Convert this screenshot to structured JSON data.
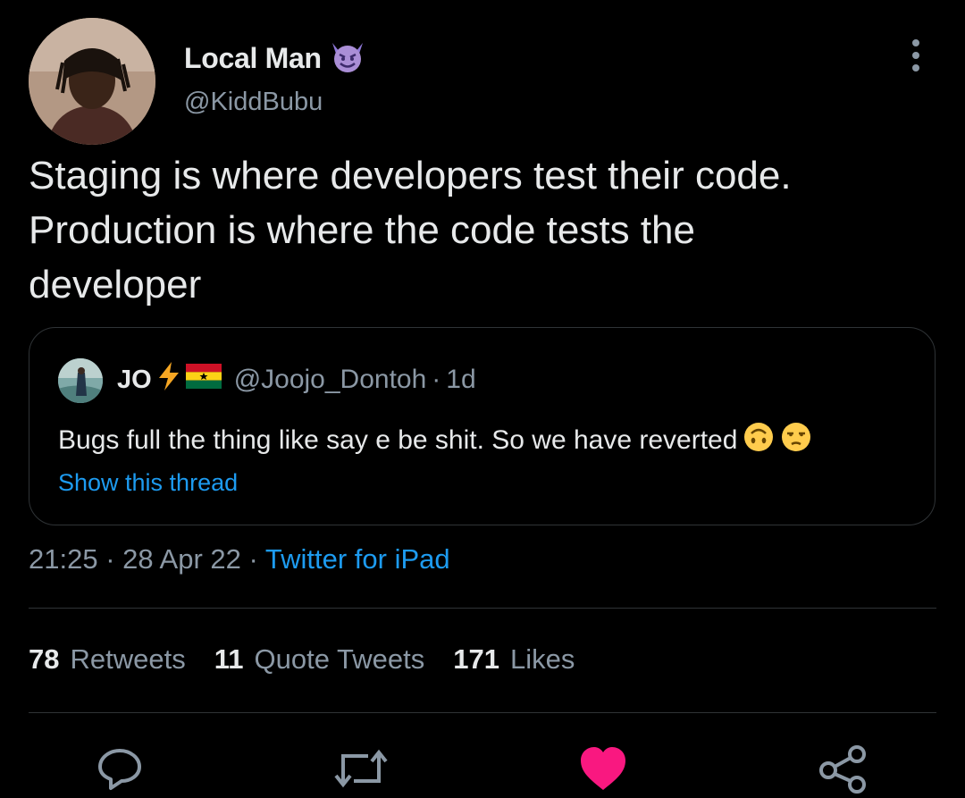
{
  "author": {
    "display_name": "Local Man",
    "handle": "@KiddBubu",
    "badge_icon": "smiling-devil-emoji-icon"
  },
  "tweet": {
    "text": "Staging is where developers test their code.\nProduction is where the code tests the\ndeveloper"
  },
  "quoted": {
    "name": "JO",
    "name_icons": [
      "lightning-emoji-icon",
      "ghana-flag-icon"
    ],
    "handle": "@Joojo_Dontoh",
    "separator": "·",
    "age": "1d",
    "text": "Bugs full the thing like say e be shit. So we have reverted",
    "text_emojis": [
      "upside-down-face-emoji-icon",
      "unamused-face-emoji-icon"
    ],
    "thread_link": "Show this thread"
  },
  "meta": {
    "time": "21:25",
    "date": "28 Apr 22",
    "source": "Twitter for iPad",
    "separator": "·"
  },
  "stats": [
    {
      "count": "78",
      "label": "Retweets"
    },
    {
      "count": "11",
      "label": "Quote Tweets"
    },
    {
      "count": "171",
      "label": "Likes"
    }
  ],
  "actions": [
    {
      "name": "reply-icon"
    },
    {
      "name": "retweet-icon"
    },
    {
      "name": "heart-icon",
      "active": true
    },
    {
      "name": "share-icon"
    }
  ],
  "colors": {
    "background": "#000000",
    "text": "#e7e9ea",
    "muted": "#8b98a5",
    "link": "#1d9bf0",
    "like": "#f91880",
    "border": "#2f3336"
  }
}
